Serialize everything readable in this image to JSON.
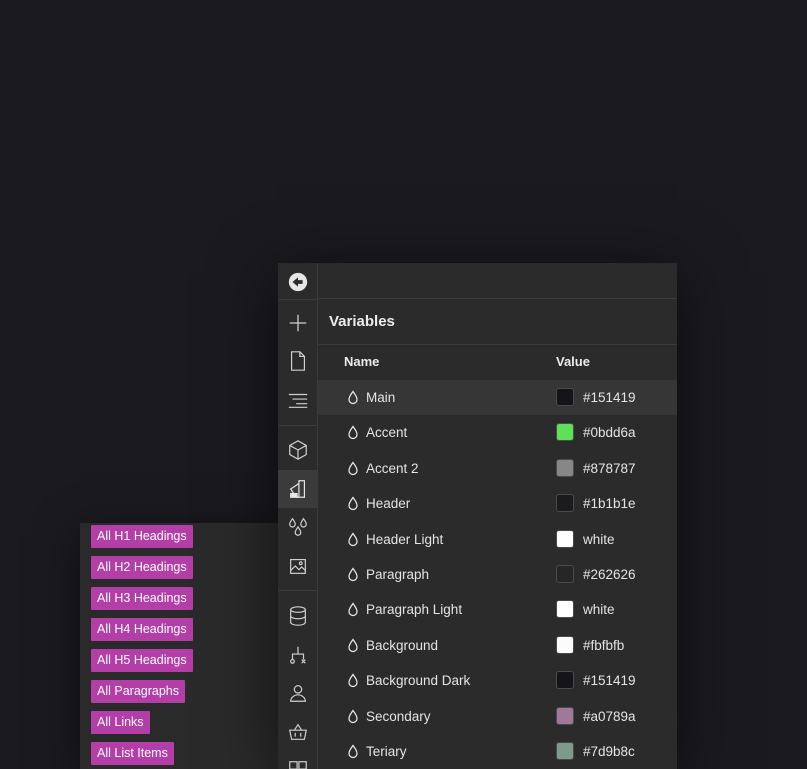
{
  "tags": [
    {
      "label": "All H1 Headings"
    },
    {
      "label": "All H2 Headings"
    },
    {
      "label": "All H3 Headings"
    },
    {
      "label": "All H4 Headings"
    },
    {
      "label": "All H5 Headings"
    },
    {
      "label": "All Paragraphs"
    },
    {
      "label": "All Links"
    },
    {
      "label": "All List Items"
    }
  ],
  "panel": {
    "title": "Variables",
    "columns": {
      "name": "Name",
      "value": "Value"
    }
  },
  "variables": [
    {
      "name": "Main",
      "value": "#151419",
      "color": "#151419"
    },
    {
      "name": "Accent",
      "value": "#0bdd6a",
      "color": "#5ee05a"
    },
    {
      "name": "Accent 2",
      "value": "#878787",
      "color": "#878787"
    },
    {
      "name": "Header",
      "value": "#1b1b1e",
      "color": "#1b1b1e"
    },
    {
      "name": "Header Light",
      "value": "white",
      "color": "#ffffff"
    },
    {
      "name": "Paragraph",
      "value": "#262626",
      "color": "#262626"
    },
    {
      "name": "Paragraph Light",
      "value": "white",
      "color": "#ffffff"
    },
    {
      "name": "Background",
      "value": "#fbfbfb",
      "color": "#fbfbfb"
    },
    {
      "name": "Background Dark",
      "value": "#151419",
      "color": "#151419"
    },
    {
      "name": "Secondary",
      "value": "#a0789a",
      "color": "#a0789a"
    },
    {
      "name": "Teriary",
      "value": "#7d9b8c",
      "color": "#7d9b8c"
    }
  ],
  "toolbar_icons": [
    "app-logo-icon",
    "add-icon",
    "page-icon",
    "navigator-icon",
    "components-icon",
    "style-manager-icon",
    "variables-icon",
    "assets-icon",
    "cms-icon",
    "logic-icon",
    "users-icon",
    "ecommerce-icon",
    "apps-icon"
  ],
  "colors": {
    "background": "#1b1a1f",
    "panel": "#2b2b2b",
    "tag": "#b43ea8",
    "selected_row": "#363636"
  }
}
